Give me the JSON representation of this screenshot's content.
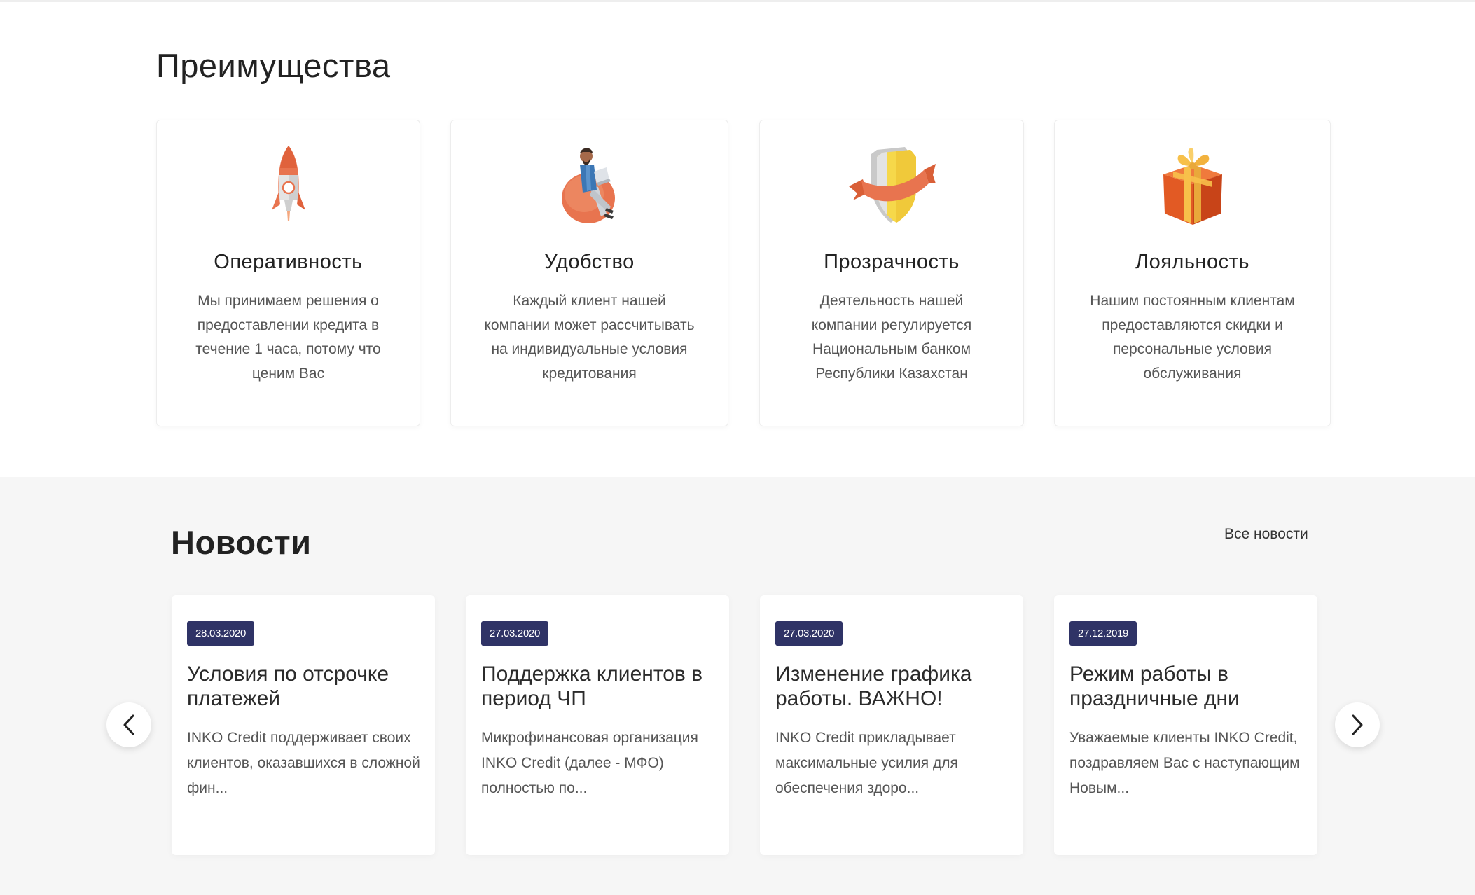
{
  "advantages": {
    "title": "Преимущества",
    "cards": [
      {
        "title": "Оперативность",
        "text": "Мы принимаем решения о предоставлении кредита в течение 1 часа, потому что ценим Вас",
        "icon": "rocket-icon"
      },
      {
        "title": "Удобство",
        "text": "Каждый клиент нашей компании может рассчитывать на индивидуальные условия кредитования",
        "icon": "person-beanbag-laptop-icon"
      },
      {
        "title": "Прозрачность",
        "text": "Деятельность нашей компании регулируется Национальным банком Республики Казахстан",
        "icon": "shield-ribbon-icon"
      },
      {
        "title": "Лояльность",
        "text": "Нашим постоянным клиентам предоставляются скидки и персональные условия обслуживания",
        "icon": "gift-box-icon"
      }
    ]
  },
  "news": {
    "title": "Новости",
    "all_link": "Все новости",
    "items": [
      {
        "date": "28.03.2020",
        "title": "Условия по отсрочке платежей",
        "excerpt": "INKO Credit поддерживает своих клиентов, оказавшихся в сложной фин..."
      },
      {
        "date": "27.03.2020",
        "title": "Поддержка клиентов в период ЧП",
        "excerpt": "Микрофинансовая организация INKO Credit (далее - МФО) полностью по..."
      },
      {
        "date": "27.03.2020",
        "title": "Изменение графика работы. ВАЖНО!",
        "excerpt": "INKO Credit прикладывает максимальные усилия для обеспечения здоро..."
      },
      {
        "date": "27.12.2019",
        "title": "Режим работы в праздничные дни",
        "excerpt": "Уважаемые клиенты INKO Credit, поздравляем Вас с наступающим Новым..."
      }
    ]
  },
  "colors": {
    "date_badge": "#2f3366",
    "section_bg": "#f6f6f6",
    "accent_orange": "#e8744f"
  }
}
